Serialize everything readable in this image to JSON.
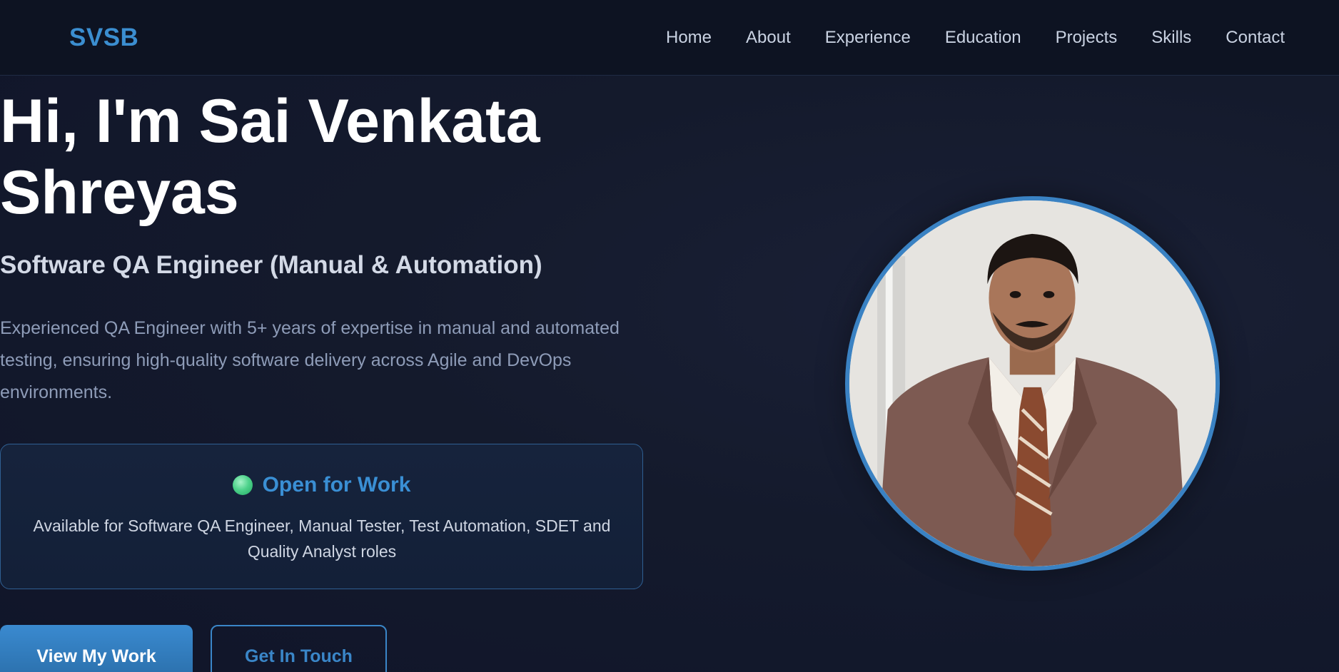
{
  "nav": {
    "logo": "SVSB",
    "links": [
      "Home",
      "About",
      "Experience",
      "Education",
      "Projects",
      "Skills",
      "Contact"
    ]
  },
  "hero": {
    "title_line1": "Hi, I'm Sai Venkata",
    "title_line2": "Shreyas",
    "subtitle": "Software QA Engineer (Manual & Automation)",
    "description": "Experienced QA Engineer with 5+ years of expertise in manual and automated testing, ensuring high-quality software delivery across Agile and DevOps environments."
  },
  "status": {
    "title": "Open for Work",
    "text": "Available for Software QA Engineer, Manual Tester, Test Automation, SDET and Quality Analyst roles",
    "dot_color": "#4fd38c"
  },
  "buttons": {
    "primary": "View My Work",
    "secondary": "Get In Touch"
  },
  "colors": {
    "accent": "#3a8fd4",
    "background": "#12172a",
    "nav_background": "#0d1322"
  },
  "icons": {
    "status": "status-dot-icon"
  }
}
